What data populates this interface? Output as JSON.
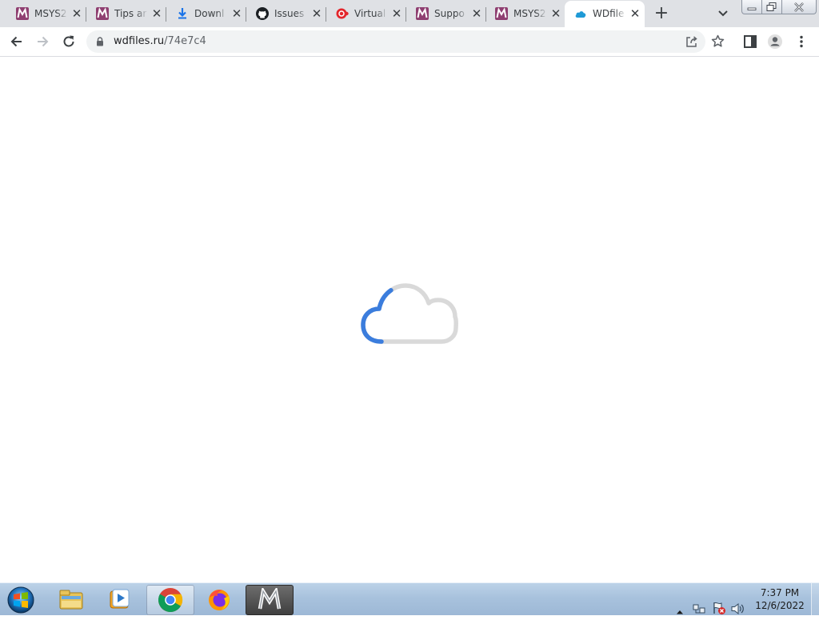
{
  "browser": {
    "tabs": [
      {
        "title": "MSYS2",
        "icon": "msys2-icon",
        "active": false
      },
      {
        "title": "Tips ar",
        "icon": "msys2-icon",
        "active": false
      },
      {
        "title": "Downl",
        "icon": "download-icon",
        "active": false
      },
      {
        "title": "Issues",
        "icon": "github-icon",
        "active": false
      },
      {
        "title": "Virtual",
        "icon": "red-badge-icon",
        "active": false
      },
      {
        "title": "Suppo",
        "icon": "msys2-icon",
        "active": false
      },
      {
        "title": "MSYS2",
        "icon": "msys2-icon",
        "active": false
      },
      {
        "title": "WDfile",
        "icon": "wdfiles-cloud-icon",
        "active": true
      }
    ],
    "close_glyph": "✕",
    "new_tab_glyph": "+",
    "address": {
      "host": "wdfiles.ru",
      "path": "/74e7c4"
    }
  },
  "page": {
    "state": "loading",
    "loader_icon": "cloud-spinner-icon",
    "loader_progress": 0.3,
    "colors": {
      "progress": "#3b7ddd",
      "track": "#d9d9d9"
    }
  },
  "taskbar": {
    "pinned": [
      "file-explorer-icon",
      "media-player-icon",
      "chrome-icon",
      "firefox-icon",
      "msys2-icon"
    ],
    "active": "chrome-icon",
    "clock": {
      "time": "7:37 PM",
      "date": "12/6/2022"
    }
  }
}
